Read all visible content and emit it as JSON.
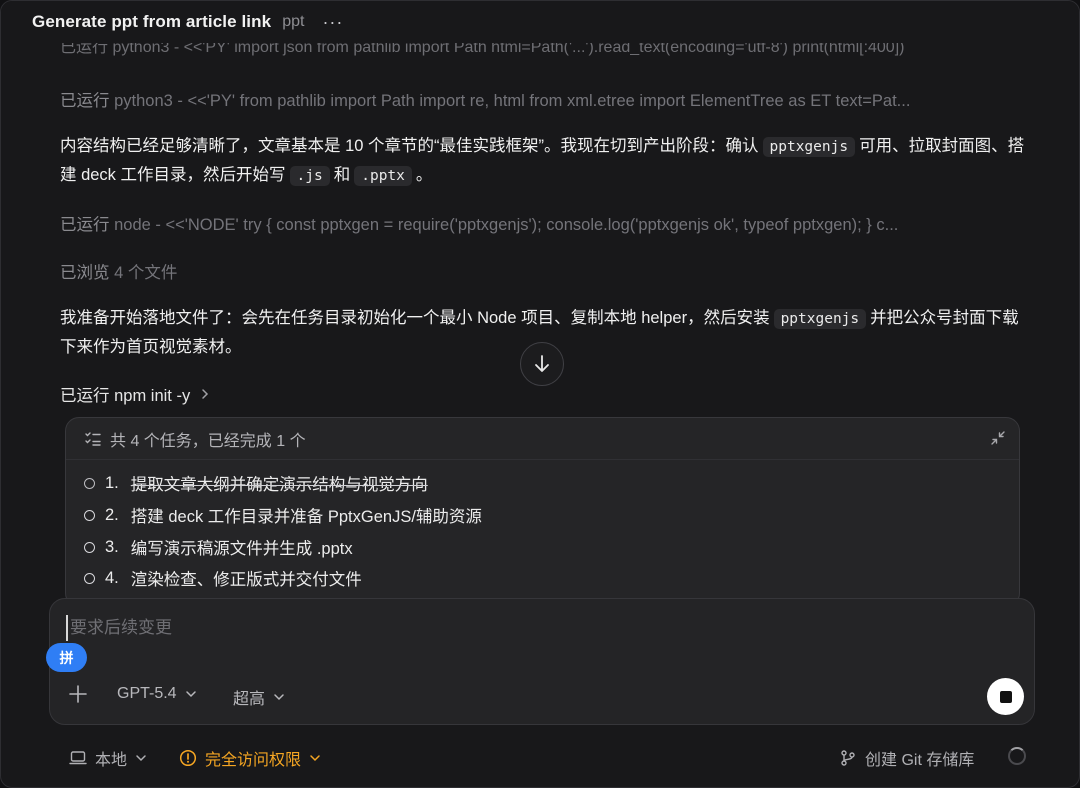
{
  "header": {
    "title": "Generate ppt from article link",
    "project": "ppt",
    "more": "···"
  },
  "conversation": {
    "faded_top": "已运行 python3 - <<'PY' import json from pathlib import Path html=Path('...').read_text(encoding='utf-8') print(html[:400])",
    "run1": {
      "prefix": "已运行",
      "command": "python3 - <<'PY' from pathlib import Path import re, html from xml.etree import ElementTree as ET text=Pat..."
    },
    "msg1": {
      "p1": "内容结构已经足够清晰了，文章基本是 10 个章节的“最佳实践框架”。我现在切到产出阶段：确认",
      "code1": "pptxgenjs",
      "p2": "可用、拉取封面图、搭建 deck 工作目录，然后开始写",
      "code2": ".js",
      "p3": "和",
      "code3": ".pptx",
      "p4": "。"
    },
    "run2": {
      "prefix": "已运行",
      "command": "node - <<'NODE' try { const pptxgen = require('pptxgenjs'); console.log('pptxgenjs ok', typeof pptxgen); } c..."
    },
    "browse": {
      "prefix": "已浏览",
      "detail": "4 个文件"
    },
    "msg2": {
      "p1": "我准备开始落地文件了：会先在任务目录初始化一个最小 Node 项目、复制本地 helper，然后安装",
      "code1": "pptxgenjs",
      "p2": "并把公众号封面下载下来作为首页视觉素材。"
    },
    "run3": {
      "prefix": "已运行",
      "command": "npm init -y"
    }
  },
  "tasks": {
    "summary": "共 4 个任务，已经完成 1 个",
    "items": [
      {
        "num": "1.",
        "label": "提取文章大纲并确定演示结构与视觉方向",
        "done": true
      },
      {
        "num": "2.",
        "label": "搭建 deck 工作目录并准备 PptxGenJS/辅助资源",
        "done": false
      },
      {
        "num": "3.",
        "label": "编写演示稿源文件并生成 .pptx",
        "done": false
      },
      {
        "num": "4.",
        "label": "渲染检查、修正版式并交付文件",
        "done": false
      }
    ]
  },
  "composer": {
    "placeholder": "要求后续变更",
    "ime_label": "拼",
    "model": "GPT-5.4",
    "effort": "超高"
  },
  "footer": {
    "env": "本地",
    "access": "完全访问权限",
    "git": "创建 Git 存储库"
  },
  "colors": {
    "accent_blue": "#2f7ef5",
    "warning": "#f5a623"
  }
}
